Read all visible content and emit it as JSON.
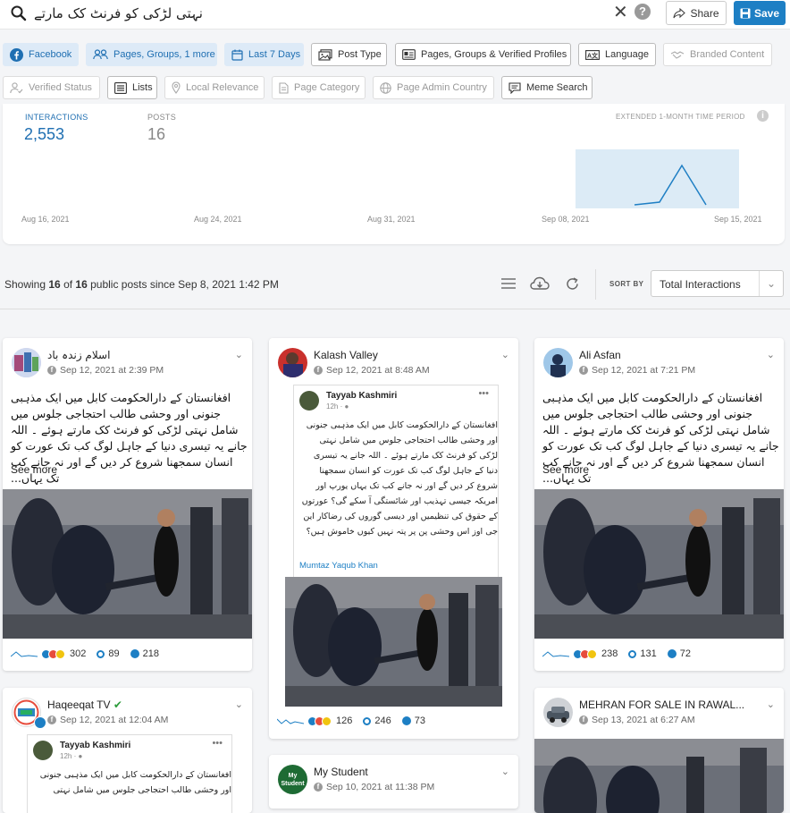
{
  "search": {
    "query": "نہتی لڑکی کو فرنٹ کک مارتے"
  },
  "header": {
    "clear_icon": "close-icon",
    "help_label": "?",
    "share_label": "Share",
    "save_label": "Save"
  },
  "filters": {
    "facebook": "Facebook",
    "pages_groups": "Pages, Groups, 1 more",
    "last7": "Last 7 Days",
    "post_type": "Post Type",
    "verified_profiles": "Pages, Groups & Verified Profiles",
    "language": "Language",
    "branded": "Branded Content",
    "verified_status": "Verified Status",
    "lists": "Lists",
    "local_relevance": "Local Relevance",
    "page_category": "Page Category",
    "admin_country": "Page Admin Country",
    "meme_search": "Meme Search"
  },
  "stats": {
    "interactions_label": "INTERACTIONS",
    "interactions_value": "2,553",
    "posts_label": "POSTS",
    "posts_value": "16",
    "extended_label": "EXTENDED 1-MONTH TIME PERIOD",
    "info_label": "i",
    "axis_dates": [
      "Aug 16, 2021",
      "Aug 24, 2021",
      "Aug 31, 2021",
      "Sep 08, 2021",
      "Sep 15, 2021"
    ]
  },
  "listing": {
    "showing_prefix": "Showing ",
    "showing_count": "16",
    "showing_of": " of ",
    "showing_total": "16",
    "showing_suffix": " public posts since Sep 8, 2021 1:42 PM",
    "sort_label": "SORT BY",
    "sort_value": "Total Interactions"
  },
  "cards": [
    {
      "name": "اسلام زندہ باد",
      "meta": "Sep 12, 2021 at 2:39 PM",
      "text": "افغانستان کے دارالحکومت کابل میں ایک مذہبی جنونی اور وحشی طالب احتجاجی جلوس میں شامل نہتی لڑکی کو فرنٹ کک مارتے ہوئے ۔ اللہ جانے یہ تیسری دنیا کے جاہل لوگ کب تک عورت کو انسان سمجھنا شروع کر دیں گے اور نہ جانے کب تک یہاں...",
      "see_more": "See more",
      "reactions": "302",
      "comments": "89",
      "shares": "218"
    },
    {
      "name": "Kalash Valley",
      "meta": "Sep 12, 2021 at 8:48 AM",
      "embed_name": "Tayyab Kashmiri",
      "embed_time": "12h · ",
      "embed_text": "افغانستان کے دارالحکومت کابل میں ایک مذہبی جنونی اور وحشی طالب احتجاجی جلوس میں شامل نہتی لڑکی کو فرنٹ کک مارتے ہوئے ۔ اللہ جانے یہ تیسری دنیا کے جاہل لوگ کب تک عورت کو انسان سمجھنا شروع کر دیں گے اور نہ جانے کب تک یہاں یورپ اور امریکہ جیسی تہذیب اور شائستگی آ سکے گی؟ عورتوں کے حقوق کی تنظیمیں اور دیسی گوروں کی رضاکار این جی اوز اس وحشی پن پر پتہ نہیں کیوں خاموش ہیں؟",
      "embed_link": "Mumtaz Yaqub Khan",
      "reactions": "126",
      "comments": "246",
      "shares": "73"
    },
    {
      "name": "Ali Asfan",
      "meta": "Sep 12, 2021 at 7:21 PM",
      "text": "افغانستان کے دارالحکومت کابل میں ایک مذہبی جنونی اور وحشی طالب احتجاجی جلوس میں شامل نہتی لڑکی کو فرنٹ کک مارتے ہوئے ۔ اللہ جانے یہ تیسری دنیا کے جاہل لوگ کب تک عورت کو انسان سمجھنا شروع کر دیں گے اور نہ جانے کب تک یہاں...",
      "see_more": "See more",
      "reactions": "238",
      "comments": "131",
      "shares": "72"
    },
    {
      "name": "Haqeeqat TV",
      "meta": "Sep 12, 2021 at 12:04 AM",
      "embed_name": "Tayyab Kashmiri",
      "embed_time": "12h · ",
      "embed_text": "افغانستان کے دارالحکومت کابل میں ایک مذہبی جنونی اور وحشی طالب احتجاجی جلوس میں شامل نہتی"
    },
    {
      "name": "My Student",
      "meta": "Sep 10, 2021 at 11:38 PM",
      "avatar_text": "My Student"
    },
    {
      "name": "MEHRAN FOR SALE IN RAWAL...",
      "meta": "Sep 13, 2021 at 6:27 AM"
    }
  ]
}
